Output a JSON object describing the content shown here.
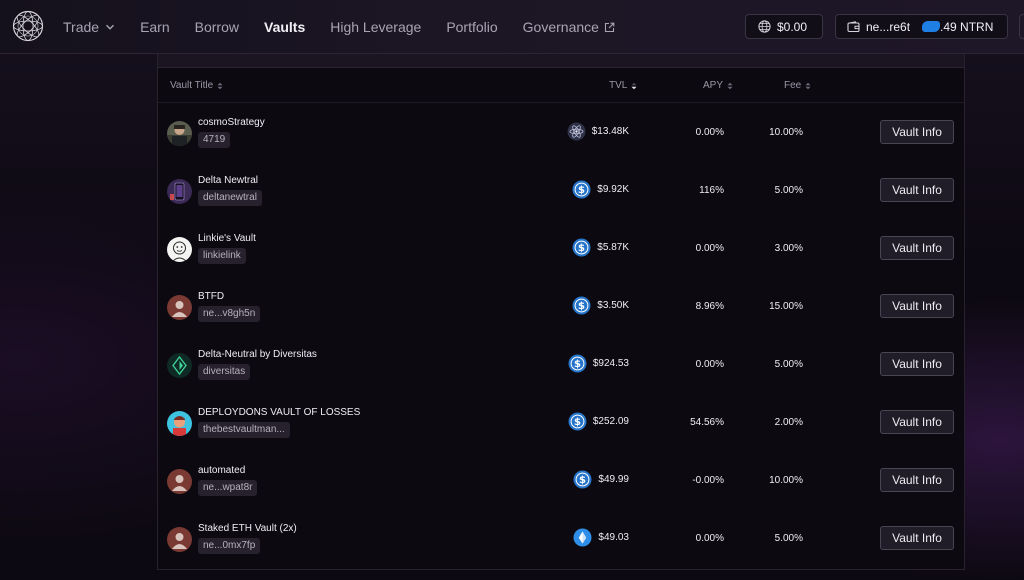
{
  "nav": {
    "trade": "Trade",
    "earn": "Earn",
    "borrow": "Borrow",
    "vaults": "Vaults",
    "high_leverage": "High Leverage",
    "portfolio": "Portfolio",
    "governance": "Governance"
  },
  "header": {
    "balance": "$0.00",
    "wallet_address": "ne...re6t",
    "wallet_balance": ".49 NTRN"
  },
  "table": {
    "columns": {
      "title": "Vault Title",
      "tvl": "TVL",
      "apy": "APY",
      "fee": "Fee"
    },
    "sorted_column": "tvl",
    "button_label": "Vault Info",
    "rows": [
      {
        "name": "cosmoStrategy",
        "tag": "4719",
        "tvl": "$13.48K",
        "apy": "0.00%",
        "fee": "10.00%",
        "coin": "atom-icon",
        "avatar": "photo-avatar"
      },
      {
        "name": "Delta Newtral",
        "tag": "deltanewtral",
        "tvl": "$9.92K",
        "apy": "116%",
        "fee": "5.00%",
        "coin": "usdc-icon",
        "avatar": "phone-avatar"
      },
      {
        "name": "Linkie's Vault",
        "tag": "linkielink",
        "tvl": "$5.87K",
        "apy": "0.00%",
        "fee": "3.00%",
        "coin": "usdc-icon",
        "avatar": "sketch-avatar"
      },
      {
        "name": "BTFD",
        "tag": "ne...v8gh5n",
        "tvl": "$3.50K",
        "apy": "8.96%",
        "fee": "15.00%",
        "coin": "usdc-icon",
        "avatar": "default-user-avatar"
      },
      {
        "name": "Delta-Neutral by Diversitas",
        "tag": "diversitas",
        "tvl": "$924.53",
        "apy": "0.00%",
        "fee": "5.00%",
        "coin": "usdc-icon",
        "avatar": "diversitas-logo-avatar"
      },
      {
        "name": "DEPLOYDONS VAULT OF LOSSES",
        "tag": "thebestvaultman...",
        "tvl": "$252.09",
        "apy": "54.56%",
        "fee": "2.00%",
        "coin": "usdc-icon",
        "avatar": "cartoon-avatar"
      },
      {
        "name": "automated",
        "tag": "ne...wpat8r",
        "tvl": "$49.99",
        "apy": "-0.00%",
        "fee": "10.00%",
        "coin": "usdc-icon",
        "avatar": "default-user-avatar"
      },
      {
        "name": "Staked ETH Vault (2x)",
        "tag": "ne...0mx7fp",
        "tvl": "$49.03",
        "apy": "0.00%",
        "fee": "5.00%",
        "coin": "steth-icon",
        "avatar": "default-user-avatar"
      }
    ]
  },
  "colors": {
    "background": "#0d0912",
    "accent_blue": "#2775ca",
    "button_bg": "#211d28"
  }
}
